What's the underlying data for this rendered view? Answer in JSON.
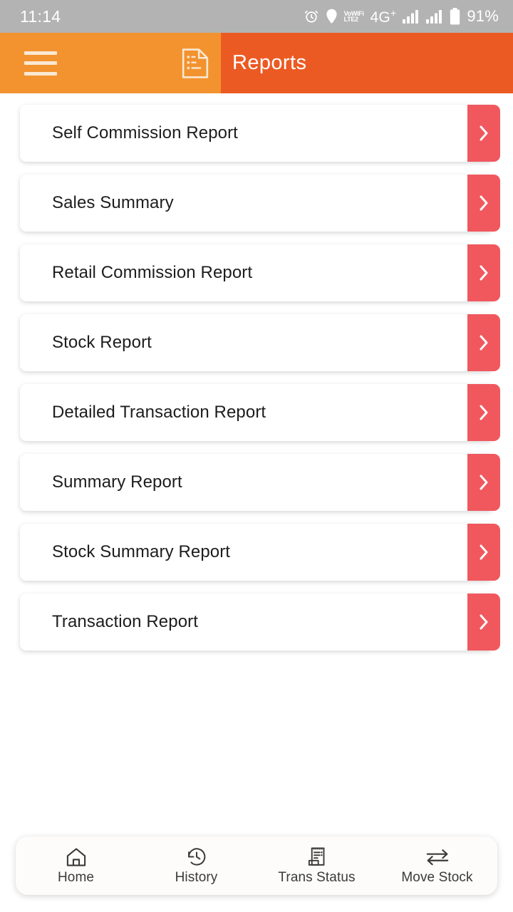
{
  "status_bar": {
    "time": "11:14",
    "alarm_icon": "alarm-clock-icon",
    "location_icon": "location-pin-icon",
    "volte_line1": "VoWiFi",
    "volte_line2": "LTE2",
    "network_base": "4G",
    "network_sup": "+",
    "signal_icon_1": "signal-bars-icon",
    "signal_icon_2": "signal-bars-icon",
    "battery_icon": "battery-icon",
    "battery_level": "91%",
    "background": "#b3b3b3"
  },
  "app_bar": {
    "menu_icon": "hamburger-menu-icon",
    "document_icon": "report-document-icon",
    "title": "Reports",
    "left_color": "#f2932f",
    "right_color": "#ec5a23"
  },
  "reports": {
    "chevron_color": "#f0585e",
    "items": [
      {
        "label": "Self Commission Report",
        "chevron": "chevron-right-icon"
      },
      {
        "label": "Sales Summary",
        "chevron": "chevron-right-icon"
      },
      {
        "label": "Retail Commission Report",
        "chevron": "chevron-right-icon"
      },
      {
        "label": "Stock Report",
        "chevron": "chevron-right-icon"
      },
      {
        "label": "Detailed Transaction Report",
        "chevron": "chevron-right-icon"
      },
      {
        "label": "Summary Report",
        "chevron": "chevron-right-icon"
      },
      {
        "label": "Stock Summary Report",
        "chevron": "chevron-right-icon"
      },
      {
        "label": "Transaction Report",
        "chevron": "chevron-right-icon"
      }
    ]
  },
  "bottom_nav": {
    "items": [
      {
        "label": "Home",
        "icon": "home-icon"
      },
      {
        "label": "History",
        "icon": "history-clock-icon"
      },
      {
        "label": "Trans Status",
        "icon": "receipt-icon"
      },
      {
        "label": "Move Stock",
        "icon": "exchange-arrows-icon"
      }
    ]
  }
}
